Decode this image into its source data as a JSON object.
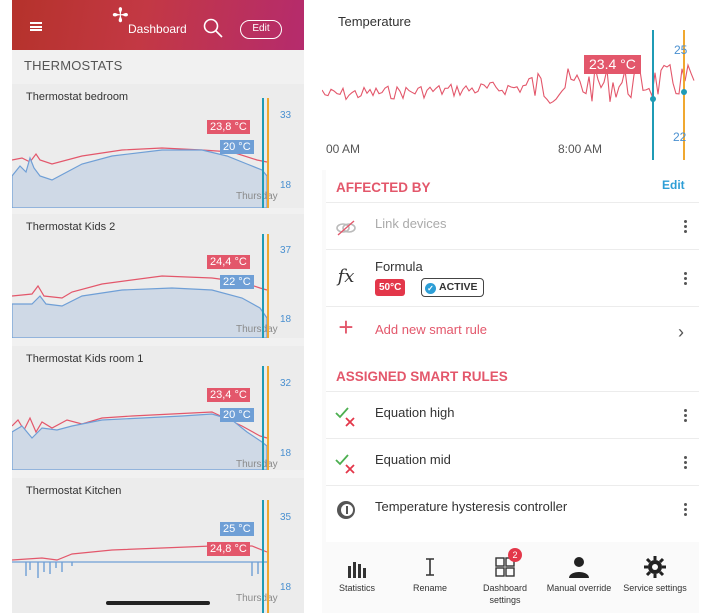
{
  "left": {
    "header": {
      "title": "Dashboard",
      "edit_label": "Edit",
      "logo_icon": "fan-logo-icon"
    },
    "section_title": "THERMOSTATS",
    "cards": [
      {
        "title": "Thermostat bedroom",
        "temp_red": "23,8 °C",
        "temp_blue": "20 °C",
        "axis_top": "33",
        "axis_bottom": "18",
        "day": "Thursday"
      },
      {
        "title": "Thermostat Kids 2",
        "temp_red": "24,4 °C",
        "temp_blue": "22 °C",
        "axis_top": "37",
        "axis_bottom": "18",
        "day": "Thursday"
      },
      {
        "title": "Thermostat Kids room 1",
        "temp_red": "23,4 °C",
        "temp_blue": "20 °C",
        "axis_top": "32",
        "axis_bottom": "18",
        "day": "Thursday"
      },
      {
        "title": "Thermostat Kitchen",
        "temp_red": "24,8 °C",
        "temp_blue": "25 °C",
        "axis_top": "35",
        "axis_bottom": "18",
        "day": "Thursday"
      }
    ]
  },
  "right": {
    "chart": {
      "title": "Temperature",
      "current_value": "23.4 °C",
      "axis_top": "25",
      "axis_bottom": "22",
      "time_left": "00 AM",
      "time_right": "8:00 AM"
    },
    "affected_by": {
      "header": "AFFECTED BY",
      "edit_label": "Edit",
      "link_devices": "Link devices",
      "formula_label": "Formula",
      "formula_value": "50°C",
      "formula_status": "ACTIVE",
      "add_rule": "Add new smart rule"
    },
    "assigned": {
      "header": "ASSIGNED SMART RULES",
      "rules": [
        "Equation high",
        "Equation mid",
        "Temperature hysteresis controller"
      ]
    },
    "nav": {
      "items": [
        "Statistics",
        "Rename",
        "Dashboard settings",
        "Manual override",
        "Service settings"
      ],
      "badge_count": "2"
    }
  },
  "colors": {
    "accent_red": "#e3576b",
    "accent_blue": "#4a90d0",
    "teal_line": "#1f9bb5",
    "orange_line": "#f0a830"
  }
}
